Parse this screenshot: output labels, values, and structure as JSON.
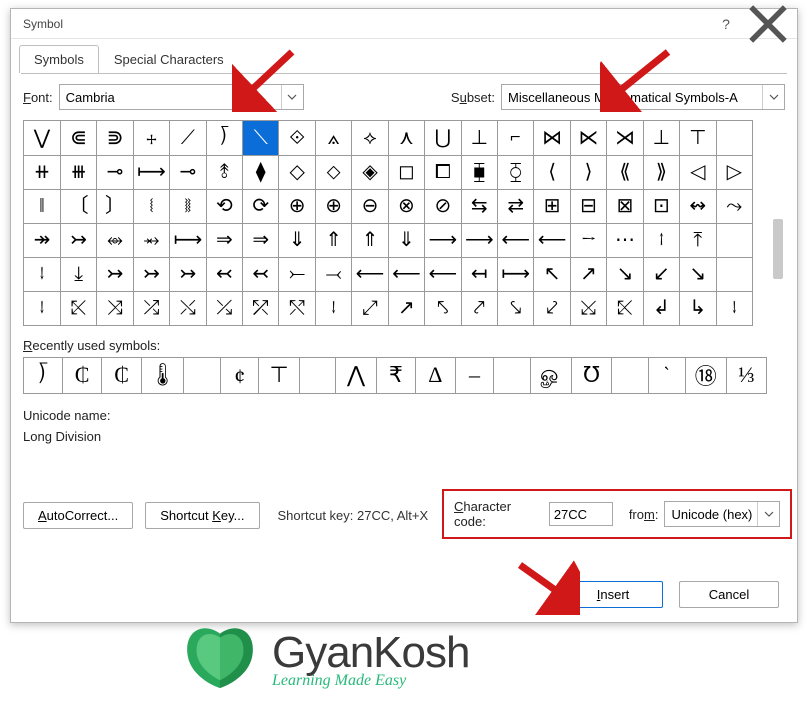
{
  "dialog": {
    "title": "Symbol",
    "tabs": [
      "Symbols",
      "Special Characters"
    ],
    "active_tab": 0,
    "font_label": "Font:",
    "font_value": "Cambria",
    "subset_label": "Subset:",
    "subset_value": "Miscellaneous Mathematical Symbols-A",
    "recent_label": "Recently used symbols:",
    "unicode_name_label": "Unicode name:",
    "unicode_name_value": "Long Division",
    "char_code_label": "Character code:",
    "char_code_value": "27CC",
    "from_label": "from:",
    "from_value": "Unicode (hex)",
    "autocorrect_btn": "AutoCorrect...",
    "shortcut_btn": "Shortcut Key...",
    "shortcut_text": "Shortcut key: 27CC, Alt+X",
    "insert_btn": "Insert",
    "cancel_btn": "Cancel"
  },
  "grid": {
    "cols": 20,
    "rows": 7,
    "selected": [
      0,
      6
    ],
    "cells": [
      [
        "⋁",
        "⋐",
        "⋑",
        "⧾",
        "⟋",
        "⟌",
        "⟍",
        "⟐",
        "⟑",
        "⟡",
        "⋏",
        "⋃",
        "⊥",
        "⌐",
        "⋈",
        "⋉",
        "⋊",
        "⊥",
        "⊤"
      ],
      [
        "⧺",
        "⧻",
        "⊸",
        "⟼",
        "⊸",
        "⥉",
        "⧫",
        "◇",
        "⬦",
        "◈",
        "◻",
        "⧠",
        "⧯",
        "⧲",
        "⟨",
        "⟩",
        "⟪",
        "⟫",
        "◁",
        "▷"
      ],
      [
        "‖",
        "〔",
        "〕",
        "⧙",
        "⧚",
        "⟲",
        "⟳",
        "⊕",
        "⊕",
        "⊖",
        "⊗",
        "⊘",
        "⇆",
        "⇄",
        "⊞",
        "⊟",
        "⊠",
        "⊡",
        "↭",
        "⤳"
      ],
      [
        "↠",
        "↣",
        "⥈",
        "⥇",
        "⟼",
        "⇒",
        "⇒",
        "⇓",
        "⇑",
        "⇑",
        "⇓",
        "⟶",
        "⟶",
        "⟵",
        "⟵",
        "→",
        "⋯",
        "↑",
        "⤒"
      ],
      [
        "↓",
        "⤓",
        "↣",
        "↣",
        "↣",
        "↢",
        "↢",
        "⤚",
        "⤙",
        "⟵",
        "⟵",
        "⟵",
        "↤",
        "⟼",
        "↖",
        "↗",
        "↘",
        "↙",
        "↘"
      ],
      [
        "↓",
        "⤪",
        "⤨",
        "⤮",
        "⤯",
        "⤰",
        "⤱",
        "⤲",
        "↓",
        "⤢",
        "↗",
        "⤣",
        "⤤",
        "⤥",
        "⤦",
        "⤩",
        "⤪",
        "↲",
        "↳",
        "↓"
      ]
    ]
  },
  "recent": [
    "⟌",
    "₵",
    "₵",
    "🌡",
    "",
    "¢",
    "⊤",
    "",
    "⋀",
    "₹",
    "Δ",
    "‒",
    "",
    "ௐ",
    "℧",
    "",
    "`",
    "⑱",
    "⅓"
  ],
  "logo": {
    "name": "GyanKosh",
    "tagline": "Learning Made Easy"
  }
}
